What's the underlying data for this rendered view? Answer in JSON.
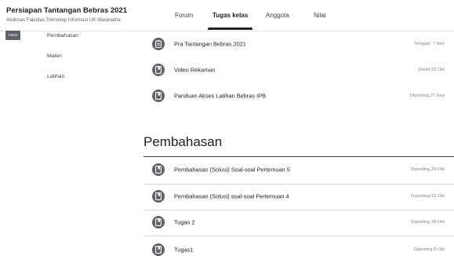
{
  "course": {
    "title": "Persiapan Tantangan Bebras 2021",
    "subtitle": "Abdimas Fakultas Teknologi Informasi UK Maranatha"
  },
  "tabs": [
    {
      "label": "Forum",
      "active": false
    },
    {
      "label": "Tugas kelas",
      "active": true
    },
    {
      "label": "Anggota",
      "active": false
    },
    {
      "label": "Nilai",
      "active": false
    }
  ],
  "sidebar": {
    "badge": "Home",
    "items": [
      {
        "label": "Pembahasan"
      },
      {
        "label": "Materi"
      },
      {
        "label": "Latihan"
      }
    ]
  },
  "upper_items": [
    {
      "title": "Pra Tantangan Bebras 2021",
      "date": "Tenggat: 7 Nov",
      "icon": "assignment-icon"
    },
    {
      "title": "Video Rekaman",
      "date": "Diedit 22 Okt",
      "icon": "material-icon"
    },
    {
      "title": "Panduan Akses Latihan Bebras IPB",
      "date": "Diposting 27 Sep",
      "icon": "material-icon"
    }
  ],
  "section": {
    "title": "Pembahasan",
    "items": [
      {
        "title": "Pembahasan (Solusi) Soal-soal Pertemuan 5",
        "date": "Diposting 29 Okt",
        "icon": "material-icon"
      },
      {
        "title": "Pembahasan (Solusi) soal-soal Pertemuan 4",
        "date": "Diposting 22 Okt",
        "icon": "material-icon"
      },
      {
        "title": "Tugas 2",
        "date": "Diposting 20 Okt",
        "icon": "material-icon"
      },
      {
        "title": "Tugas1",
        "date": "Diposting 8 Okt",
        "icon": "material-icon"
      }
    ]
  },
  "colors": {
    "icon_bg": "#5f6368",
    "accent": "#202124"
  }
}
